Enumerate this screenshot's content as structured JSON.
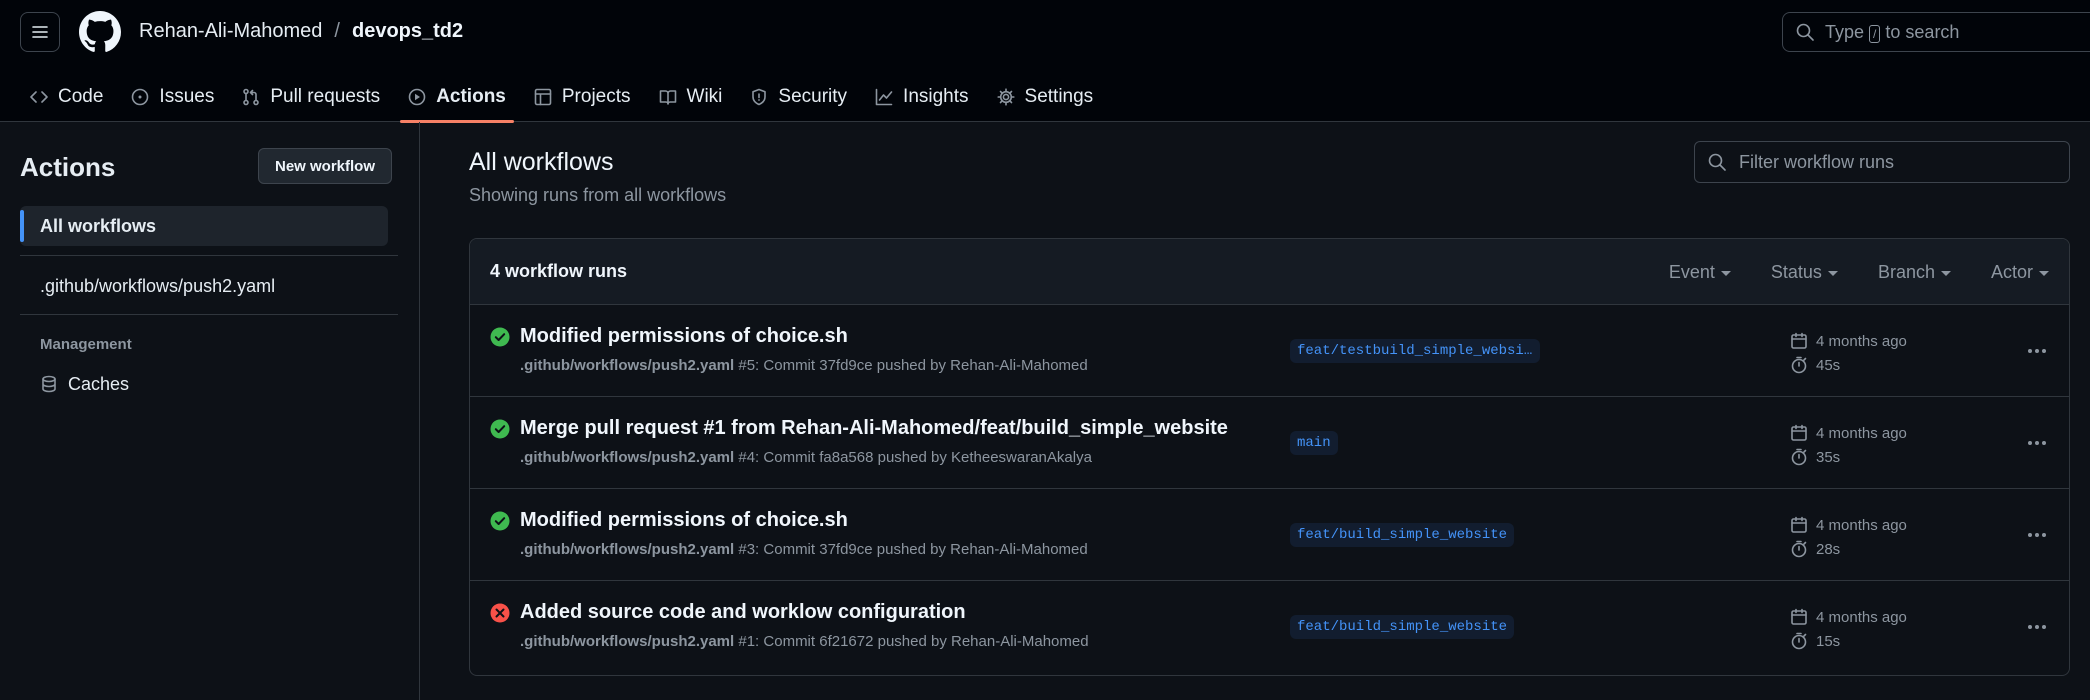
{
  "header": {
    "owner": "Rehan-Ali-Mahomed",
    "separator": "/",
    "repo": "devops_td2",
    "search_prefix": "Type",
    "search_key": "/",
    "search_suffix": "to search"
  },
  "repo_nav": {
    "tabs": [
      {
        "label": "Code",
        "icon": "code-icon"
      },
      {
        "label": "Issues",
        "icon": "issue-icon"
      },
      {
        "label": "Pull requests",
        "icon": "pull-request-icon"
      },
      {
        "label": "Actions",
        "icon": "play-icon"
      },
      {
        "label": "Projects",
        "icon": "table-icon"
      },
      {
        "label": "Wiki",
        "icon": "book-icon"
      },
      {
        "label": "Security",
        "icon": "shield-icon"
      },
      {
        "label": "Insights",
        "icon": "graph-icon"
      },
      {
        "label": "Settings",
        "icon": "gear-icon"
      }
    ],
    "active": "Actions"
  },
  "sidebar": {
    "title": "Actions",
    "new_workflow": "New workflow",
    "all_workflows": "All workflows",
    "workflow_file": ".github/workflows/push2.yaml",
    "management_label": "Management",
    "caches": "Caches"
  },
  "main": {
    "title": "All workflows",
    "subtitle": "Showing runs from all workflows",
    "filter_placeholder": "Filter workflow runs",
    "runs_count": "4 workflow runs",
    "filters": [
      "Event",
      "Status",
      "Branch",
      "Actor"
    ]
  },
  "runs": [
    {
      "status": "success",
      "title": "Modified permissions of choice.sh",
      "workflow": ".github/workflows/push2.yaml",
      "detail": "#5: Commit 37fd9ce pushed by Rehan-Ali-Mahomed",
      "branch": "feat/testbuild_simple_website",
      "when": "4 months ago",
      "duration": "45s"
    },
    {
      "status": "success",
      "title": "Merge pull request #1 from Rehan-Ali-Mahomed/feat/build_simple_website",
      "workflow": ".github/workflows/push2.yaml",
      "detail": "#4: Commit fa8a568 pushed by KetheeswaranAkalya",
      "branch": "main",
      "when": "4 months ago",
      "duration": "35s"
    },
    {
      "status": "success",
      "title": "Modified permissions of choice.sh",
      "workflow": ".github/workflows/push2.yaml",
      "detail": "#3: Commit 37fd9ce pushed by Rehan-Ali-Mahomed",
      "branch": "feat/build_simple_website",
      "when": "4 months ago",
      "duration": "28s"
    },
    {
      "status": "failure",
      "title": "Added source code and worklow configuration",
      "workflow": ".github/workflows/push2.yaml",
      "detail": "#1: Commit 6f21672 pushed by Rehan-Ali-Mahomed",
      "branch": "feat/build_simple_website",
      "when": "4 months ago",
      "duration": "15s"
    }
  ],
  "colors": {
    "background": "#0d1117",
    "success": "#3fb950",
    "failure": "#f85149",
    "accent": "#4493f8",
    "tab_underline": "#f78166"
  }
}
